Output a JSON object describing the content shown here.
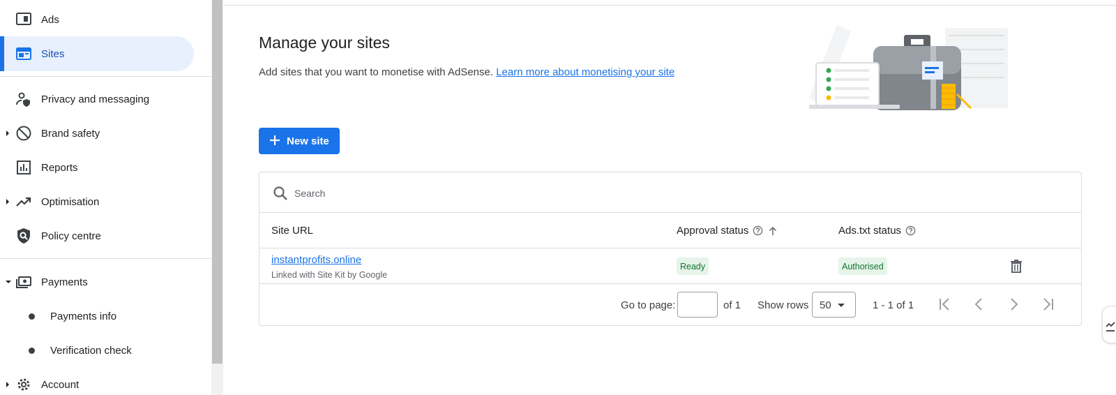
{
  "sidebar": {
    "items": [
      {
        "label": "Ads",
        "icon": "ads-icon"
      },
      {
        "label": "Sites",
        "icon": "sites-icon",
        "active": true
      },
      {
        "label": "Privacy and messaging",
        "icon": "privacy-icon"
      },
      {
        "label": "Brand safety",
        "icon": "block-icon",
        "expandable": true
      },
      {
        "label": "Reports",
        "icon": "reports-icon"
      },
      {
        "label": "Optimisation",
        "icon": "trending-up-icon",
        "expandable": true
      },
      {
        "label": "Policy centre",
        "icon": "policy-shield-icon"
      },
      {
        "label": "Payments",
        "icon": "payments-icon",
        "expanded": true
      },
      {
        "label": "Payments info",
        "sub": true
      },
      {
        "label": "Verification check",
        "sub": true
      },
      {
        "label": "Account",
        "icon": "gear-icon",
        "expandable": true
      }
    ]
  },
  "main": {
    "title": "Manage your sites",
    "subtitle": "Add sites that you want to monetise with AdSense.",
    "learn_more": "Learn more about monetising your site",
    "new_site_label": "New site"
  },
  "table": {
    "search_placeholder": "Search",
    "columns": {
      "site_url": "Site URL",
      "approval_status": "Approval status",
      "ads_txt_status": "Ads.txt status"
    },
    "rows": [
      {
        "site_url": "instantprofits.online",
        "sub_text": "Linked with Site Kit by Google",
        "approval_status": "Ready",
        "ads_txt_status": "Authorised"
      }
    ],
    "footer": {
      "go_to_page": "Go to page:",
      "of_pages": "of 1",
      "show_rows": "Show rows",
      "rows_value": "50",
      "range": "1 - 1 of 1"
    }
  },
  "colors": {
    "accent": "#1a73e8",
    "active_bg": "#e8f0fe",
    "chip_bg": "#e6f4ea",
    "chip_text": "#137333"
  }
}
